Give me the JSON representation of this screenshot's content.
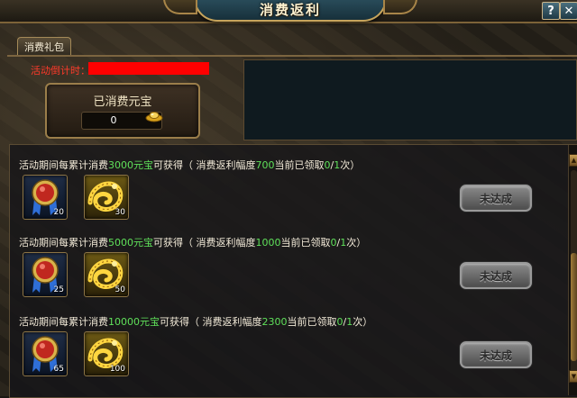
{
  "window": {
    "title": "消费返利",
    "help_label": "?",
    "close_label": "✕"
  },
  "tabs": [
    {
      "label": "消费礼包",
      "active": true
    }
  ],
  "countdown": {
    "label": "活动倒计时：",
    "value": "██████████"
  },
  "spent": {
    "title": "已消费元宝",
    "value": "0",
    "icon": "gold-ingot-icon"
  },
  "rewards": [
    {
      "prefix": "活动期间每累计消费",
      "amount": "3000",
      "unit": "元宝",
      "suffix": "可获得（ 消费返利幅度",
      "rebate": "700",
      "claimed_text": "当前已领取",
      "claimed": "0",
      "slash": "/",
      "limit": "1",
      "times": "次）",
      "items": [
        {
          "icon": "blue-medal-icon",
          "count": "20"
        },
        {
          "icon": "gold-dragon-icon",
          "count": "30"
        }
      ],
      "status": "未达成"
    },
    {
      "prefix": "活动期间每累计消费",
      "amount": "5000",
      "unit": "元宝",
      "suffix": "可获得（ 消费返利幅度",
      "rebate": "1000",
      "claimed_text": "当前已领取",
      "claimed": "0",
      "slash": "/",
      "limit": "1",
      "times": "次）",
      "items": [
        {
          "icon": "blue-medal-icon",
          "count": "25"
        },
        {
          "icon": "gold-dragon-icon",
          "count": "50"
        }
      ],
      "status": "未达成"
    },
    {
      "prefix": "活动期间每累计消费",
      "amount": "10000",
      "unit": "元宝",
      "suffix": "可获得（ 消费返利幅度",
      "rebate": "2300",
      "claimed_text": "当前已领取",
      "claimed": "0",
      "slash": "/",
      "limit": "1",
      "times": "次）",
      "items": [
        {
          "icon": "blue-medal-icon",
          "count": "65"
        },
        {
          "icon": "gold-dragon-icon",
          "count": "100"
        }
      ],
      "status": "未达成"
    }
  ],
  "colors": {
    "highlight_green": "#5fe05a",
    "countdown_red": "#ff3a2a",
    "redaction_red": "#ff0000",
    "frame_gold": "#c6a45c"
  }
}
